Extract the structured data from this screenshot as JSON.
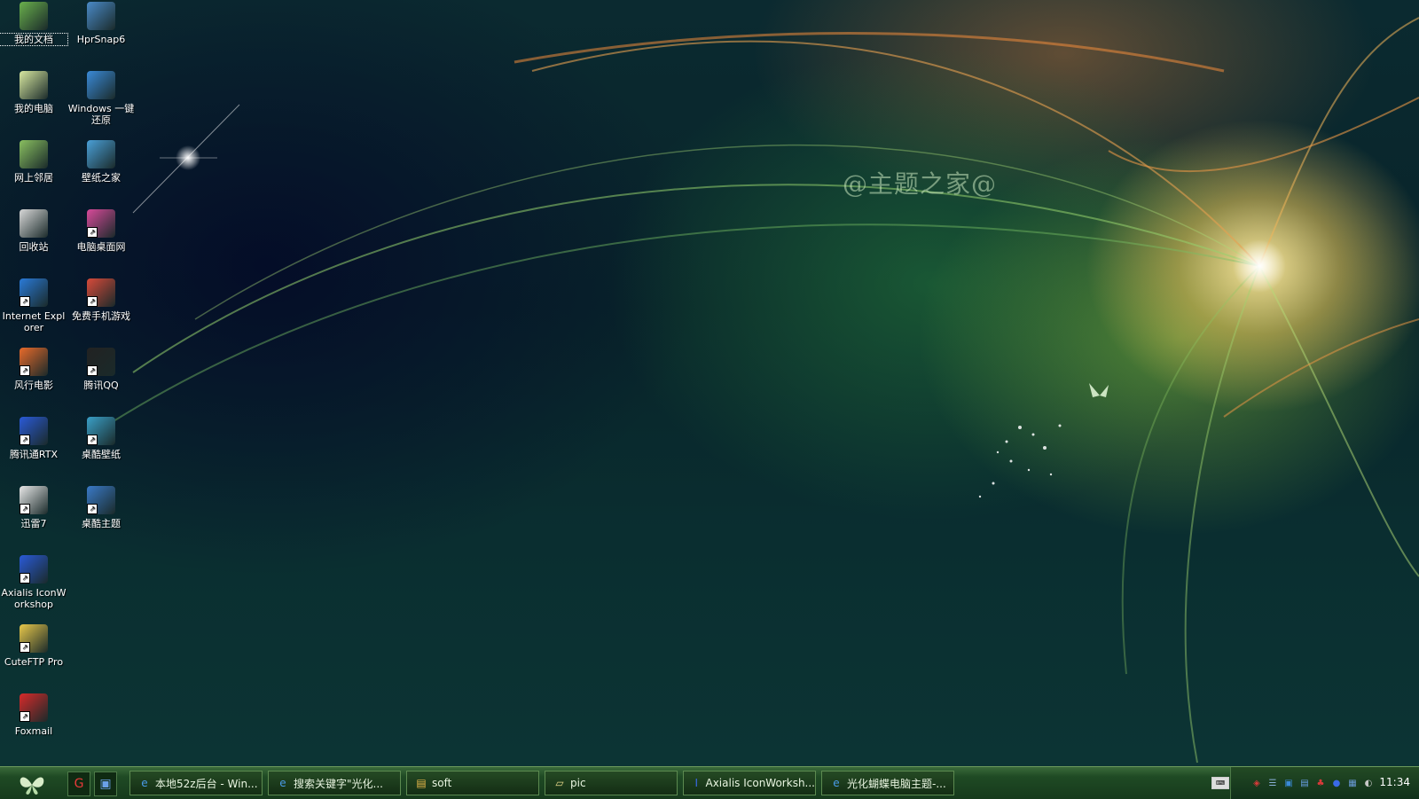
{
  "wallpaper": {
    "watermark": "@主题之家@"
  },
  "desktop": {
    "icons": [
      {
        "label": "我的文档",
        "icon": "folder-documents-icon",
        "color": "#6ab04c"
      },
      {
        "label": "HprSnap6",
        "icon": "camera-icon",
        "color": "#4a8ac8"
      },
      {
        "label": "我的电脑",
        "icon": "computer-icon",
        "color": "#d8e8a0"
      },
      {
        "label": "Windows 一键还原",
        "icon": "restore-icon",
        "color": "#3a8ad8"
      },
      {
        "label": "网上邻居",
        "icon": "network-icon",
        "color": "#8ac060"
      },
      {
        "label": "壁纸之家",
        "icon": "wallpaper-home-icon",
        "color": "#4aa0d8"
      },
      {
        "label": "回收站",
        "icon": "recycle-bin-icon",
        "color": "#d8d8d8"
      },
      {
        "label": "电脑桌面网",
        "icon": "desktop-web-icon",
        "color": "#d84a9a"
      },
      {
        "label": "Internet Explorer",
        "icon": "ie-icon",
        "color": "#2a7ad8"
      },
      {
        "label": "免费手机游戏",
        "icon": "game-icon",
        "color": "#d84a3a"
      },
      {
        "label": "风行电影",
        "icon": "movie-icon",
        "color": "#e86a2a"
      },
      {
        "label": "腾讯QQ",
        "icon": "qq-penguin-icon",
        "color": "#222222"
      },
      {
        "label": "腾讯通RTX",
        "icon": "rtx-icon",
        "color": "#2a5ad8"
      },
      {
        "label": "桌酷壁纸",
        "icon": "zhuoku-wallpaper-icon",
        "color": "#3aa0c8"
      },
      {
        "label": "迅雷7",
        "icon": "thunder-icon",
        "color": "#e8e8e8"
      },
      {
        "label": "桌酷主题",
        "icon": "zhuoku-theme-icon",
        "color": "#3a7ac8"
      },
      {
        "label": "Axialis IconWorkshop",
        "icon": "axialis-icon",
        "color": "#2a5ad8"
      },
      {
        "label": "CuteFTP Pro",
        "icon": "cuteftp-icon",
        "color": "#e8c84a"
      },
      {
        "label": "Foxmail",
        "icon": "foxmail-icon",
        "color": "#d82a2a"
      }
    ]
  },
  "taskbar": {
    "quick_launch": [
      {
        "icon": "foxmail-icon",
        "glyph": "G",
        "color": "#e83a3a"
      },
      {
        "icon": "show-desktop-icon",
        "glyph": "▣",
        "color": "#6aa0e8"
      }
    ],
    "tasks": [
      {
        "label": "本地52z后台 - Win...",
        "icon": "ie-icon",
        "glyph": "e",
        "color": "#4a9ae8"
      },
      {
        "label": "搜索关键字\"光化...",
        "icon": "ie-icon",
        "glyph": "e",
        "color": "#4a9ae8"
      },
      {
        "label": "soft",
        "icon": "folder-icon",
        "glyph": "▤",
        "color": "#e8b84a"
      },
      {
        "label": "pic",
        "icon": "folder-open-icon",
        "glyph": "▱",
        "color": "#e8d88a"
      },
      {
        "label": "Axialis IconWorksh...",
        "icon": "axialis-icon",
        "glyph": "I",
        "color": "#3a6ae8"
      },
      {
        "label": "光化蝴蝶电脑主题-...",
        "icon": "ie-icon",
        "glyph": "e",
        "color": "#4a9ae8"
      }
    ],
    "tray": [
      {
        "icon": "shield-icon",
        "glyph": "◈",
        "color": "#d83a3a"
      },
      {
        "icon": "network-tray-icon",
        "glyph": "☰",
        "color": "#8ab0d8"
      },
      {
        "icon": "app-tray-icon",
        "glyph": "▣",
        "color": "#3a8ad8"
      },
      {
        "icon": "app2-tray-icon",
        "glyph": "▤",
        "color": "#6aa0e8"
      },
      {
        "icon": "qq-tray-icon",
        "glyph": "♣",
        "color": "#d83a3a"
      },
      {
        "icon": "browser-tray-icon",
        "glyph": "●",
        "color": "#3a6ae8"
      },
      {
        "icon": "monitor-tray-icon",
        "glyph": "▦",
        "color": "#6a9ad8"
      },
      {
        "icon": "volume-icon",
        "glyph": "◐",
        "color": "#c8c8c8"
      }
    ],
    "clock": "11:34"
  }
}
